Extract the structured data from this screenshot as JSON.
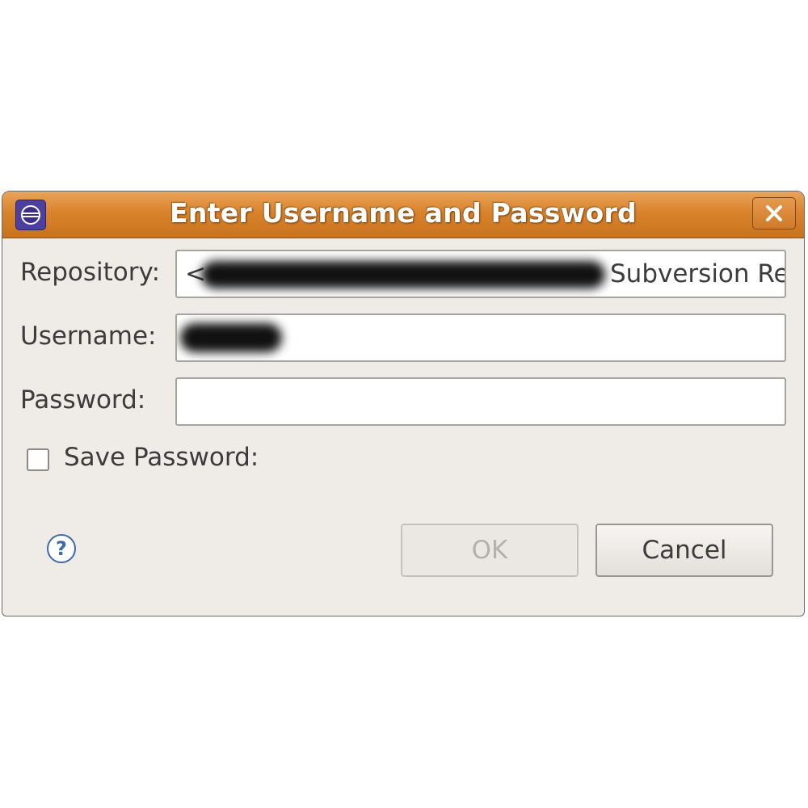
{
  "dialog": {
    "title": "Enter Username and Password",
    "close_icon": "close-icon",
    "app_icon": "eclipse-icon"
  },
  "form": {
    "repository_label": "Repository:",
    "repository_visible_suffix": "Subversion Re",
    "repository_prefix_char": "<",
    "username_label": "Username:",
    "password_label": "Password:",
    "password_value": "",
    "save_password_label": "Save Password:",
    "save_password_checked": false
  },
  "buttons": {
    "ok_label": "OK",
    "ok_enabled": false,
    "cancel_label": "Cancel"
  },
  "colors": {
    "titlebar": "#d9832c",
    "dialog_bg": "#efebe7",
    "help_icon": "#3d6aa8"
  }
}
